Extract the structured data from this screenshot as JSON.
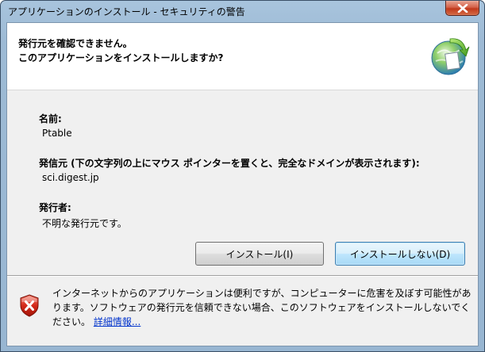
{
  "window": {
    "title": "アプリケーションのインストール - セキュリティの警告",
    "close_icon": "close-icon"
  },
  "header": {
    "line1": "発行元を確認できません。",
    "line2": "このアプリケーションをインストールしますか?",
    "icon": "application-install-icon"
  },
  "fields": {
    "name_label": "名前:",
    "name_value": "Ptable",
    "source_label": "発信元 (下の文字列の上にマウス ポインターを置くと、完全なドメインが表示されます):",
    "source_value": "sci.digest.jp",
    "publisher_label": "発行者:",
    "publisher_value": "不明な発行元です。"
  },
  "buttons": {
    "install": "インストール(I)",
    "dont_install": "インストールしない(D)"
  },
  "footer": {
    "icon": "shield-warning-icon",
    "message": "インターネットからのアプリケーションは便利ですが、コンピューターに危害を及ぼす可能性があります。ソフトウェアの発行元を信頼できない場合、このソフトウェアをインストールしないでください。",
    "link": "詳細情報..."
  },
  "colors": {
    "link": "#0033cc",
    "close_button": "#c1391b",
    "frame": "#98b6d2"
  }
}
